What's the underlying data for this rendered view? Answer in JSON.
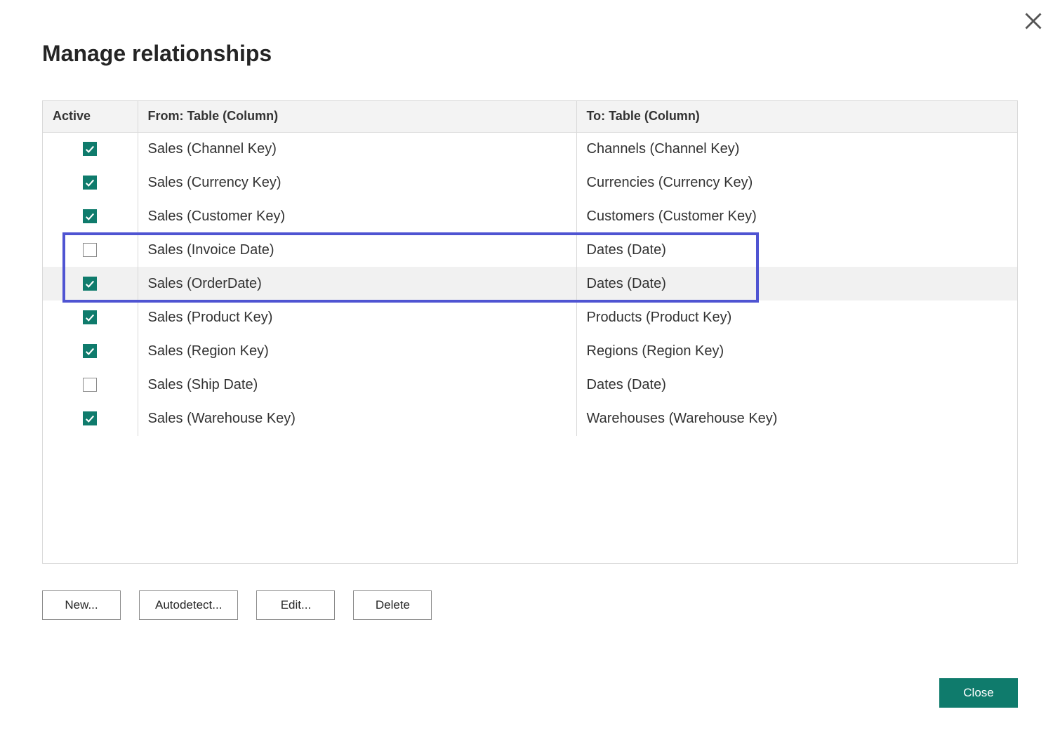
{
  "dialog": {
    "title": "Manage relationships",
    "close_label": "Close"
  },
  "columns": {
    "active": "Active",
    "from": "From: Table (Column)",
    "to": "To: Table (Column)"
  },
  "rows": [
    {
      "active": true,
      "from": "Sales (Channel Key)",
      "to": "Channels (Channel Key)",
      "selected": false,
      "highlighted": false
    },
    {
      "active": true,
      "from": "Sales (Currency Key)",
      "to": "Currencies (Currency Key)",
      "selected": false,
      "highlighted": false
    },
    {
      "active": true,
      "from": "Sales (Customer Key)",
      "to": "Customers (Customer Key)",
      "selected": false,
      "highlighted": false
    },
    {
      "active": false,
      "from": "Sales (Invoice Date)",
      "to": "Dates (Date)",
      "selected": false,
      "highlighted": true
    },
    {
      "active": true,
      "from": "Sales (OrderDate)",
      "to": "Dates (Date)",
      "selected": true,
      "highlighted": true
    },
    {
      "active": true,
      "from": "Sales (Product Key)",
      "to": "Products (Product Key)",
      "selected": false,
      "highlighted": false
    },
    {
      "active": true,
      "from": "Sales (Region Key)",
      "to": "Regions (Region Key)",
      "selected": false,
      "highlighted": false
    },
    {
      "active": false,
      "from": "Sales (Ship Date)",
      "to": "Dates (Date)",
      "selected": false,
      "highlighted": false
    },
    {
      "active": true,
      "from": "Sales (Warehouse Key)",
      "to": "Warehouses (Warehouse Key)",
      "selected": false,
      "highlighted": false
    }
  ],
  "buttons": {
    "new": "New...",
    "autodetect": "Autodetect...",
    "edit": "Edit...",
    "delete": "Delete"
  },
  "colors": {
    "accent": "#0f7b6c",
    "highlight_border": "#4f54d2"
  }
}
